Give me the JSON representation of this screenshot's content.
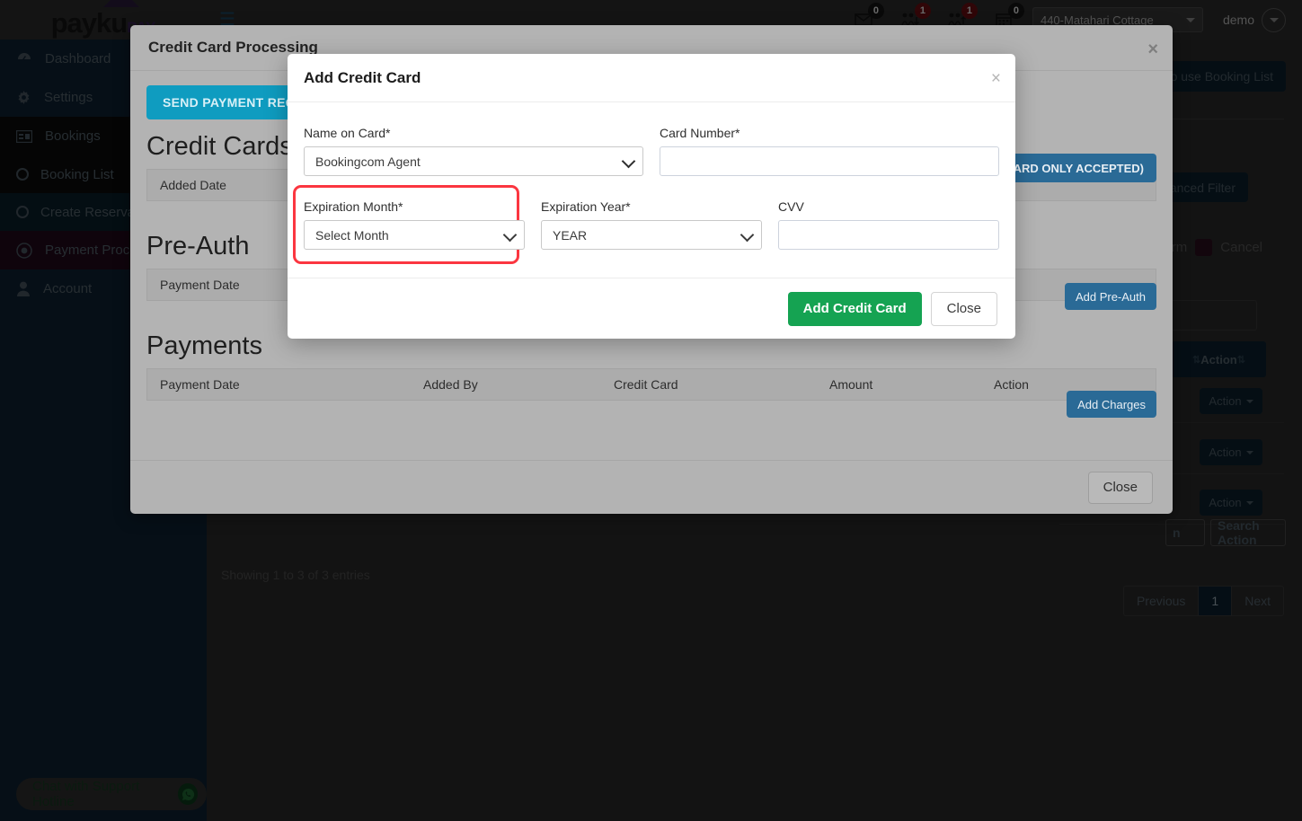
{
  "navbar": {
    "brand_main": "payku",
    "brand_suffix": "PAY",
    "hamburger_icon": "hamburger-menu-icon",
    "icons": [
      {
        "name": "envelope-icon",
        "badge": "0",
        "badge_style": "dark"
      },
      {
        "name": "guests-arrival-icon",
        "badge": "1",
        "badge_style": "red"
      },
      {
        "name": "guests-departure-icon",
        "badge": "1",
        "badge_style": "red"
      },
      {
        "name": "calendar-icon",
        "badge": "0",
        "badge_style": "dark"
      }
    ],
    "property_selected": "440-Matahari Cottage",
    "user_name": "demo"
  },
  "sidebar": {
    "items": [
      {
        "label": "Dashboard",
        "icon": "dashboard-icon",
        "state": "normal"
      },
      {
        "label": "Settings",
        "icon": "gear-icon",
        "state": "normal"
      },
      {
        "label": "Bookings",
        "icon": "bookings-icon",
        "state": "open"
      }
    ],
    "sub_items": [
      {
        "label": "Booking List",
        "active": true
      },
      {
        "label": "Create Reservation",
        "active": false
      }
    ],
    "items_after": [
      {
        "label": "Payment Processing",
        "icon": "payment-processing-icon",
        "state": "selected"
      },
      {
        "label": "Account",
        "icon": "user-icon",
        "state": "normal"
      }
    ],
    "chat_widget": {
      "label": "Chat with Support Hotline",
      "icon": "whatsapp-icon"
    }
  },
  "background_page": {
    "how_to_button": "How to use Booking List",
    "advanced_filter_button": "Advanced Filter",
    "legend_confirm": "Confirm",
    "legend_cancel": "Cancel",
    "table_header_action": "Action",
    "action_button": "Action",
    "search_action_placeholder": "Search Action",
    "search_left_fragment": "n",
    "showing_entries": "Showing 1 to 3 of 3 entries",
    "pagination": {
      "previous": "Previous",
      "current_page": "1",
      "next": "Next"
    }
  },
  "outer_modal": {
    "title": "Credit Card Processing",
    "close_icon": "close-icon",
    "send_payment_request_button": "SEND PAYMENT REQUEST",
    "credit_cards": {
      "section_title": "Credit Cards",
      "columns": [
        "Added Date"
      ],
      "add_button": "ADD CREDIT CARD (VISA / MASTERCARD ONLY ACCEPTED)"
    },
    "pre_auth": {
      "section_title": "Pre-Auth",
      "columns": [
        "Payment Date"
      ],
      "add_button": "Add Pre-Auth"
    },
    "payments": {
      "section_title": "Payments",
      "columns": [
        "Payment Date",
        "Added By",
        "Credit Card",
        "Amount",
        "Action"
      ],
      "add_button": "Add Charges"
    },
    "footer_close_button": "Close"
  },
  "inner_modal": {
    "title": "Add Credit Card",
    "close_icon": "close-icon",
    "fields": {
      "name_on_card": {
        "label": "Name on Card*",
        "value": "Bookingcom Agent",
        "type": "select"
      },
      "card_number": {
        "label": "Card Number*",
        "value": "",
        "placeholder": "",
        "type": "text"
      },
      "expiration_month": {
        "label": "Expiration Month*",
        "value": "Select Month",
        "type": "select",
        "highlighted": true
      },
      "expiration_year": {
        "label": "Expiration Year*",
        "value": "YEAR",
        "type": "select"
      },
      "cvv": {
        "label": "CVV",
        "value": "",
        "placeholder": "",
        "type": "text"
      }
    },
    "submit_button": "Add Credit Card",
    "close_button": "Close"
  },
  "colors": {
    "accent_teal": "#0f9cc0",
    "accent_blue": "#2a6a96",
    "accent_green": "#15a352",
    "highlight_red": "#fb3640",
    "sidebar_bg": "#0e2233",
    "modal_bg": "#b3b3b3"
  }
}
